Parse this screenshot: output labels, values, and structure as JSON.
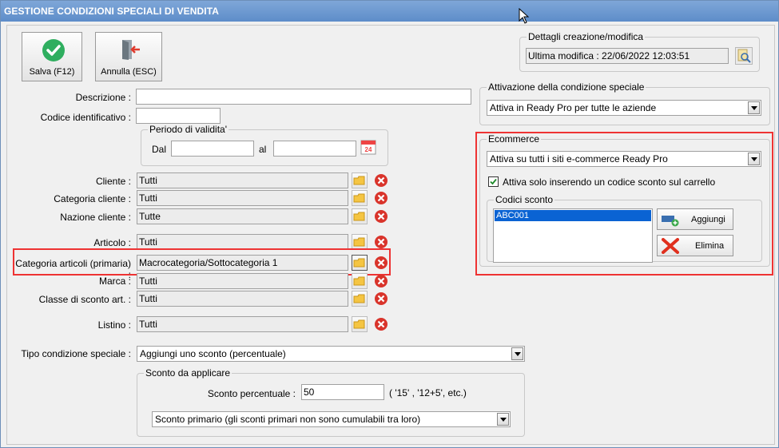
{
  "window": {
    "title": "GESTIONE CONDIZIONI SPECIALI DI VENDITA"
  },
  "toolbar": {
    "save_label": "Salva (F12)",
    "cancel_label": "Annulla (ESC)",
    "save_icon": "check-circle-icon",
    "cancel_icon": "exit-door-icon"
  },
  "details": {
    "title": "Dettagli creazione/modifica",
    "last_modified": "Ultima modifica : 22/06/2022  12:03:51"
  },
  "form": {
    "descrizione_label": "Descrizione :",
    "descrizione_value": "",
    "codice_label": "Codice identificativo :",
    "codice_value": "",
    "periodo_title": "Periodo di validita'",
    "dal_label": "Dal",
    "dal_value": "",
    "al_label": "al",
    "al_value": "",
    "calendar_text": "24",
    "filters": [
      {
        "label": "Cliente :",
        "value": "Tutti"
      },
      {
        "label": "Categoria cliente :",
        "value": "Tutti"
      },
      {
        "label": "Nazione cliente :",
        "value": "Tutte"
      },
      {
        "label": "Articolo :",
        "value": "Tutti"
      },
      {
        "label": "Categoria articoli (primaria) :",
        "value": "Macrocategoria/Sottocategoria 1"
      },
      {
        "label": "Marca :",
        "value": "Tutti"
      },
      {
        "label": "Classe di sconto art. :",
        "value": "Tutti"
      },
      {
        "label": "Listino :",
        "value": "Tutti"
      }
    ],
    "tipo_label": "Tipo condizione speciale :",
    "tipo_value": "Aggiungi uno sconto (percentuale)",
    "sconto_title": "Sconto da applicare",
    "sconto_label": "Sconto percentuale :",
    "sconto_value": "50",
    "sconto_hint": "( '15' , '12+5', etc.)",
    "sconto_tipo_value": "Sconto primario (gli sconti primari non sono cumulabili tra loro)"
  },
  "attivazione": {
    "title": "Attivazione della condizione speciale",
    "value": "Attiva in Ready Pro per tutte le aziende"
  },
  "ecommerce": {
    "title": "Ecommerce",
    "value": "Attiva su tutti i siti e-commerce Ready Pro",
    "checkbox_label": "Attiva solo inserendo un codice sconto sul carrello",
    "checkbox_checked": true,
    "codici_title": "Codici sconto",
    "codici": [
      "ABC001"
    ],
    "add_label": "Aggiungi",
    "delete_label": "Elimina"
  }
}
